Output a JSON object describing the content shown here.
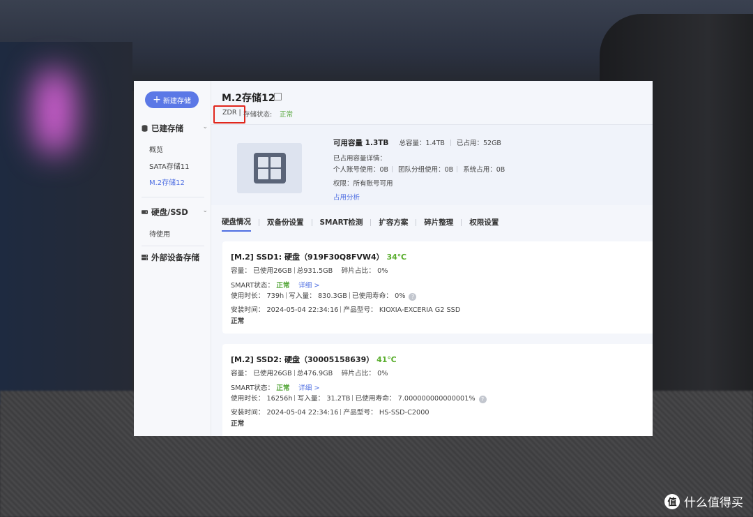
{
  "sidebar": {
    "new_button": "新建存储",
    "groups": [
      {
        "label": "已建存储",
        "items": [
          "概览",
          "SATA存储11",
          "M.2存储12"
        ]
      },
      {
        "label": "硬盘/SSD",
        "items": [
          "待使用"
        ]
      },
      {
        "label": "外部设备存储",
        "items": []
      }
    ]
  },
  "header": {
    "title": "M.2存储12",
    "raid": "ZDR |",
    "status_label": "存储状态:",
    "status_value": "正常"
  },
  "overview": {
    "available": "可用容量 1.3TB",
    "total": "总容量：1.4TB",
    "used": "已占用：52GB",
    "detail_title": "已占用容量详情：",
    "personal": "个人账号使用：0B",
    "team": "团队分组使用：0B",
    "system": "系统占用：0B",
    "permission": "权限：所有账号可用",
    "analysis_link": "占用分析"
  },
  "tabs": [
    "硬盘情况",
    "双备份设置",
    "SMART检测",
    "扩容方案",
    "碎片整理",
    "权限设置"
  ],
  "disks": [
    {
      "title": "[M.2] SSD1:  硬盘（919F30Q8FVW4）",
      "temp": "34℃",
      "capacity_label": "容量：",
      "used": "已使用26GB",
      "total": "总931.5GB",
      "fragment": "碎片占比：  0%",
      "smart_label": "SMART状态：",
      "smart_value": "正常",
      "detail_link": "详细 >",
      "hours": "使用时长：  739h",
      "written": "写入量：  830.3GB",
      "life": "已使用寿命：  0%",
      "install": "安装时间：  2024-05-04 22:34:16",
      "model": "产品型号：  KIOXIA-EXCERIA G2 SSD",
      "status": "正常"
    },
    {
      "title": "[M.2] SSD2:  硬盘（30005158639）",
      "temp": "41℃",
      "capacity_label": "容量：",
      "used": "已使用26GB",
      "total": "总476.9GB",
      "fragment": "碎片占比：  0%",
      "smart_label": "SMART状态：",
      "smart_value": "正常",
      "detail_link": "详细 >",
      "hours": "使用时长：  16256h",
      "written": "写入量：  31.2TB",
      "life": "已使用寿命：  7.000000000000001%",
      "install": "安装时间：  2024-05-04 22:34:16",
      "model": "产品型号：  HS-SSD-C2000",
      "status": "正常"
    }
  ],
  "watermark": {
    "glyph": "值",
    "text": "什么值得买"
  },
  "colors": {
    "accent": "#4e6ee2",
    "ok": "#55a63a",
    "highlight": "#e0261c"
  }
}
